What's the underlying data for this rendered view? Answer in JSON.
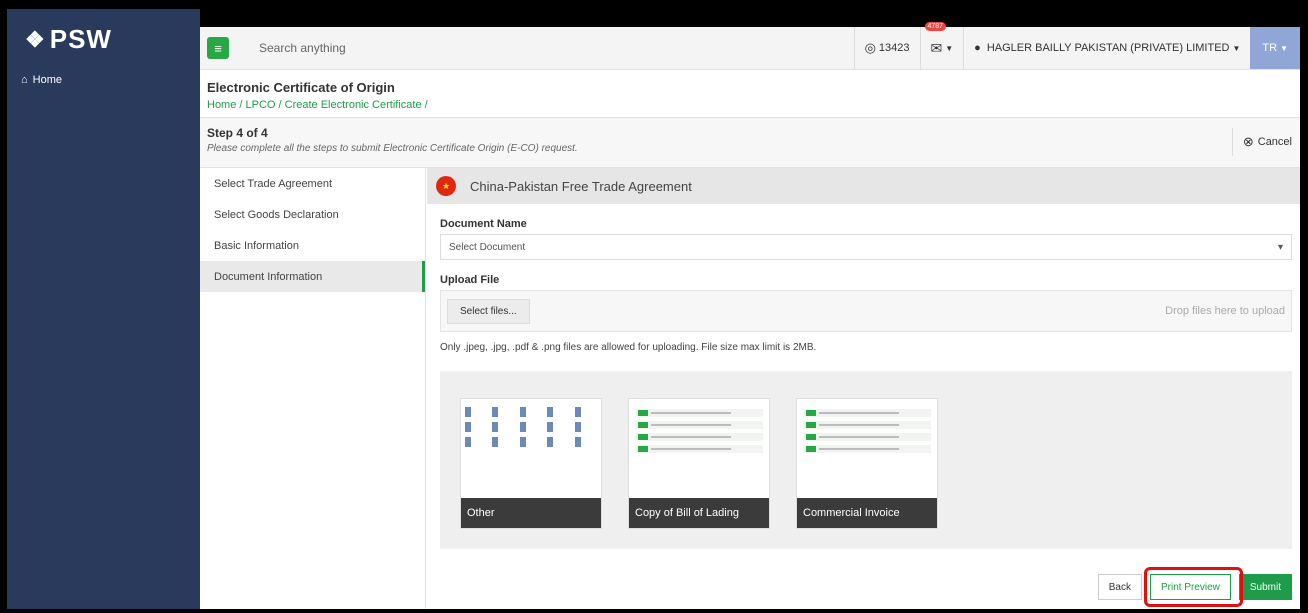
{
  "app": {
    "logo": "PSW"
  },
  "sidebar": {
    "home_label": "Home"
  },
  "topbar": {
    "search_placeholder": "Search anything",
    "points": "13423",
    "mail_badge": "4787",
    "user_name": "HAGLER BAILLY PAKISTAN (PRIVATE) LIMITED",
    "lang": "TR"
  },
  "header": {
    "title": "Electronic Certificate of Origin",
    "breadcrumb": "Home / LPCO / Create Electronic Certificate /"
  },
  "step": {
    "title": "Step 4 of 4",
    "description": "Please complete all the steps to submit Electronic Certificate Origin (E-CO) request.",
    "cancel_label": "Cancel"
  },
  "steps": [
    {
      "label": "Select Trade Agreement"
    },
    {
      "label": "Select Goods Declaration"
    },
    {
      "label": "Basic Information"
    },
    {
      "label": "Document Information"
    }
  ],
  "main": {
    "agreement": "China-Pakistan Free Trade Agreement",
    "document_name_label": "Document Name",
    "document_select": "Select Document",
    "upload_label": "Upload File",
    "select_files": "Select files...",
    "drop_text": "Drop files here to upload",
    "hint": "Only .jpeg, .jpg, .pdf & .png files are allowed for uploading. File size max limit is 2MB.",
    "thumbnails": [
      {
        "caption": "Other"
      },
      {
        "caption": "Copy of Bill of Lading"
      },
      {
        "caption": "Commercial Invoice"
      }
    ],
    "buttons": {
      "back": "Back",
      "print_preview": "Print Preview",
      "submit": "Submit"
    }
  },
  "colors": {
    "sidebar": "#2a3a5c",
    "accent": "#1f9c49",
    "highlight": "#e01010"
  },
  "icons": [
    "psw-logo-icon",
    "home-icon",
    "menu-icon",
    "coin-icon",
    "envelope-icon",
    "user-icon",
    "cancel-circle-icon",
    "china-flag-icon",
    "dropdown-caret-icon"
  ]
}
